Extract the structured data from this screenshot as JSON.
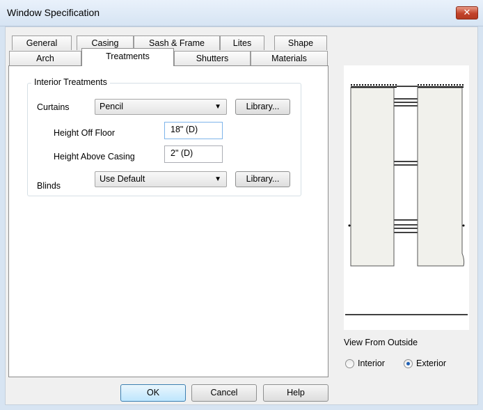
{
  "window": {
    "title": "Window Specification",
    "close_glyph": "✕"
  },
  "tabs_row1": [
    "General",
    "Casing",
    "Sash & Frame",
    "Lites",
    "Shape"
  ],
  "tabs_row2": [
    "Arch",
    "Treatments",
    "Shutters",
    "Materials"
  ],
  "active_tab": "Treatments",
  "treatments": {
    "group_label": "Interior Treatments",
    "curtains_label": "Curtains",
    "curtains_value": "Pencil",
    "library_label": "Library...",
    "height_off_floor_label": "Height Off Floor",
    "height_off_floor_value": "18\" (D)",
    "height_above_casing_label": "Height Above Casing",
    "height_above_casing_value": "2\" (D)",
    "blinds_label": "Blinds",
    "blinds_value": "Use Default",
    "blinds_library_label": "Library..."
  },
  "preview": {
    "view_label": "View From Outside",
    "options": [
      "Interior",
      "Exterior"
    ],
    "selected": "Exterior"
  },
  "buttons": {
    "ok": "OK",
    "cancel": "Cancel",
    "help": "Help"
  },
  "icons": {
    "dropdown": "chevron-down-icon",
    "close": "close-icon",
    "preview": "window-preview-icon"
  }
}
